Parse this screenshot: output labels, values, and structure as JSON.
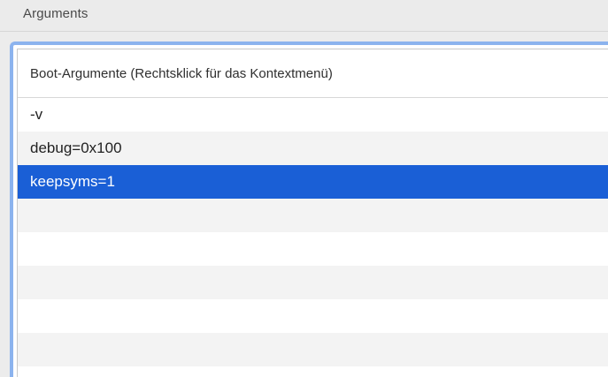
{
  "section": {
    "title": "Arguments"
  },
  "table": {
    "header": "Boot-Argumente (Rechtsklick für das Kontextmenü)",
    "rows": [
      {
        "value": "-v",
        "selected": false
      },
      {
        "value": "debug=0x100",
        "selected": false
      },
      {
        "value": "keepsyms=1",
        "selected": true
      },
      {
        "value": "",
        "selected": false
      },
      {
        "value": "",
        "selected": false
      },
      {
        "value": "",
        "selected": false
      },
      {
        "value": "",
        "selected": false
      },
      {
        "value": "",
        "selected": false
      }
    ]
  },
  "colors": {
    "selection": "#1a5fd6",
    "focus_ring": "#8cb3ee",
    "alt_row": "#f3f3f3",
    "background": "#ececec"
  }
}
